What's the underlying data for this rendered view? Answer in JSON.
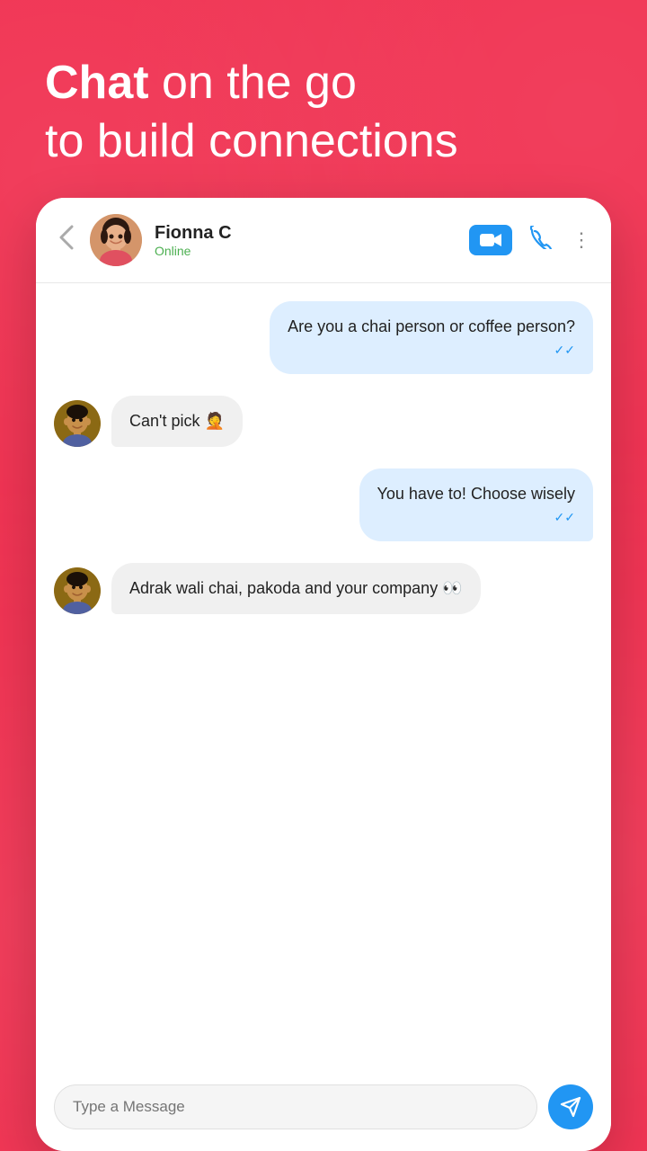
{
  "header": {
    "line1_bold": "Chat",
    "line1_rest": " on the go",
    "line2": "to build connections"
  },
  "topbar": {
    "back_label": "‹",
    "contact_name": "Fionna C",
    "contact_status": "Online",
    "video_icon": "video-camera",
    "phone_icon": "phone",
    "more_icon": "⋮"
  },
  "messages": [
    {
      "id": "msg1",
      "type": "sent",
      "text": "Are you a chai person or coffee person?",
      "ticks": "✓✓",
      "show_avatar": false
    },
    {
      "id": "msg2",
      "type": "received",
      "text": "Can't pick 🤦",
      "show_avatar": true
    },
    {
      "id": "msg3",
      "type": "sent",
      "text": "You have to! Choose wisely",
      "ticks": "✓✓",
      "show_avatar": false
    },
    {
      "id": "msg4",
      "type": "received",
      "text": "Adrak wali chai, pakoda and your company 👀",
      "show_avatar": true
    }
  ],
  "input": {
    "placeholder": "Type a Message",
    "send_icon": "send"
  }
}
